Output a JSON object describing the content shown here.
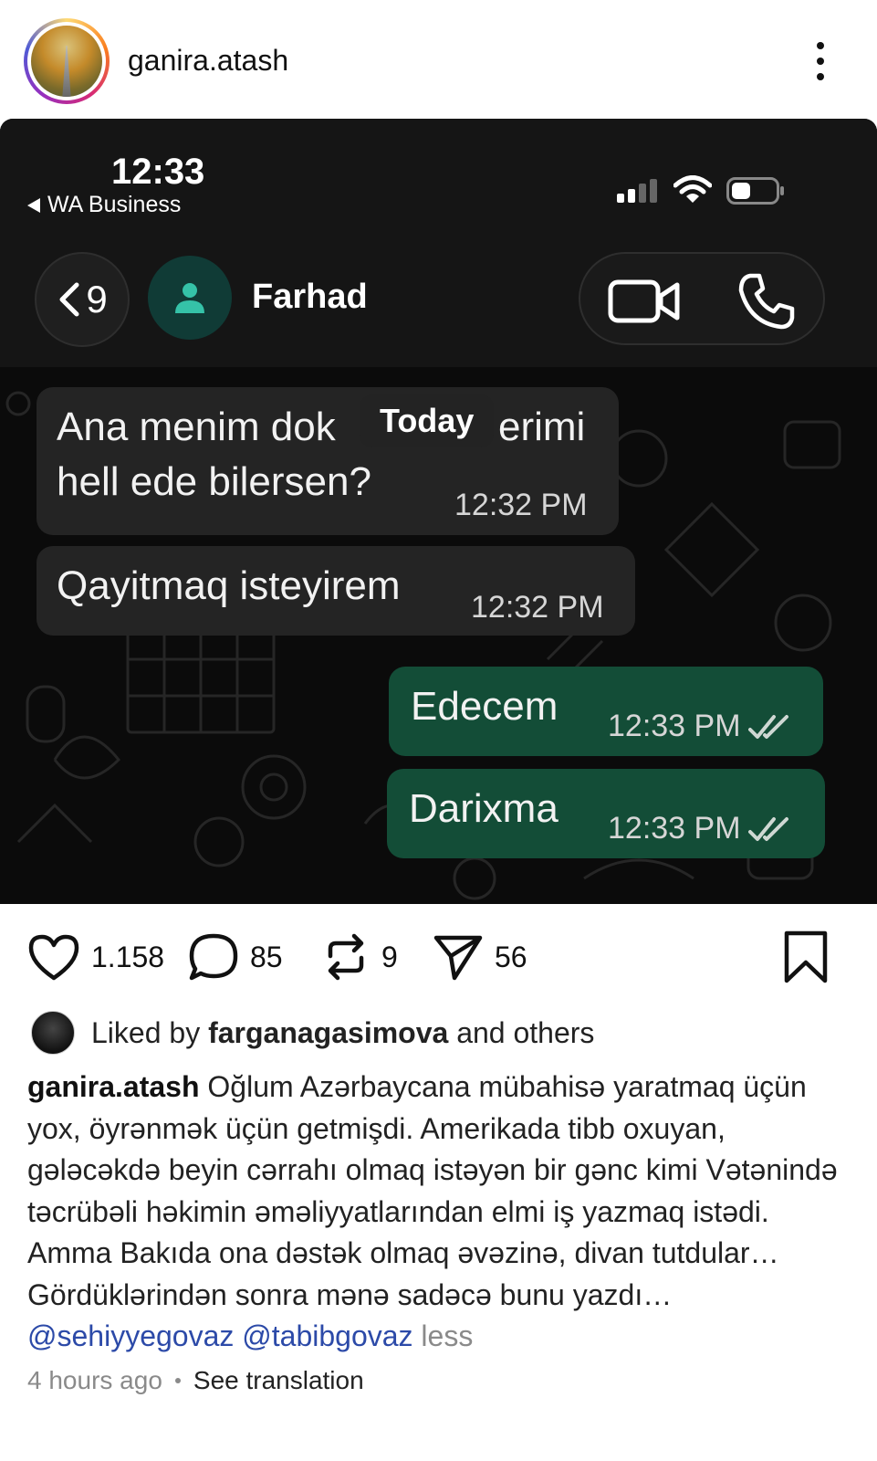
{
  "post": {
    "username": "ganira.atash",
    "more_icon": "more-vertical-icon"
  },
  "screenshot": {
    "status_bar": {
      "time": "12:33",
      "back_app": "WA Business",
      "icons": [
        "signal-icon",
        "wifi-icon",
        "battery-icon"
      ]
    },
    "header": {
      "back_count": "9",
      "contact_name": "Farhad",
      "icons": [
        "person-icon",
        "video-call-icon",
        "phone-call-icon"
      ]
    },
    "date_chip": "Today",
    "messages": [
      {
        "direction": "in",
        "line1": "Ana menim dok",
        "line1_end": "erimi",
        "line2": "hell ede bilersen?",
        "time": "12:32 PM"
      },
      {
        "direction": "in",
        "text": "Qayitmaq isteyirem",
        "time": "12:32 PM"
      },
      {
        "direction": "out",
        "text": "Edecem",
        "time": "12:33 PM",
        "status": "read"
      },
      {
        "direction": "out",
        "text": "Darixma",
        "time": "12:33 PM",
        "status": "read"
      }
    ]
  },
  "actions": {
    "likes": "1.158",
    "comments": "85",
    "reposts": "9",
    "shares": "56"
  },
  "liked_by": {
    "prefix": "Liked by",
    "user": "farganagasimova",
    "suffix": "and others"
  },
  "caption": {
    "username": "ganira.atash",
    "text": "Oğlum Azərbaycana mübahisə yaratmaq üçün yox, öyrənmək üçün getmişdi. Amerikada tibb oxuyan, gələcəkdə beyin cərrahı olmaq istəyən bir gənc kimi Vətənində təcrübəli həkimin əməliyyatlarından elmi iş yazmaq istədi. Amma Bakıda ona dəstək olmaq əvəzinə, divan tutdular… Gördüklərindən sonra mənə sadəcə bunu yazdı…",
    "mentions": [
      "@sehiyyegovaz",
      "@tabibgovaz"
    ],
    "less": "less"
  },
  "meta": {
    "time_ago": "4 hours ago",
    "translate": "See translation"
  }
}
